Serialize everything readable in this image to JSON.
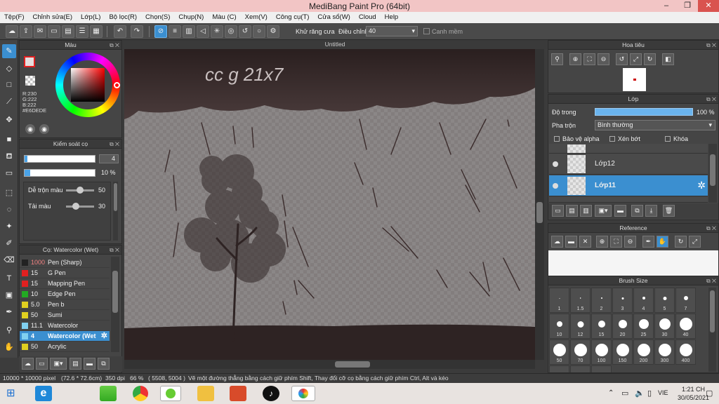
{
  "title": "MediBang Paint Pro (64bit)",
  "window_controls": {
    "minimize": "–",
    "restore": "❐",
    "close": "✕"
  },
  "menu": [
    "Tệp(F)",
    "Chỉnh sửa(E)",
    "Lớp(L)",
    "Bộ lọc(R)",
    "Chọn(S)",
    "Chụp(N)",
    "Màu (C)",
    "Xem(V)",
    "Công cụ(T)",
    "Cửa sổ(W)",
    "Cloud",
    "Help"
  ],
  "toolbar": {
    "antialias_label": "Khử răng cưa",
    "adjust_label": "Điều chỉnh",
    "adjust_value": "40",
    "smooth_label": "Canh mềm"
  },
  "color_panel": {
    "title": "Màu",
    "r": "R:230",
    "g": "G:222",
    "b": "B:222",
    "hex": "#E6DEDE",
    "fg": "#e6dede"
  },
  "brush_control": {
    "title": "Kiểm soát cọ",
    "size": "4",
    "opacity": "10 %",
    "blend_label": "Dễ trộn màu",
    "blend_value": "50",
    "resample_label": "Tải màu",
    "resample_value": "30"
  },
  "brush_panel": {
    "title": "Cọ: Watercolor (Wet)",
    "items": [
      {
        "size": "1000",
        "name": "Pen (Sharp)",
        "color": "#222222"
      },
      {
        "size": "15",
        "name": "G Pen",
        "color": "#e02020"
      },
      {
        "size": "15",
        "name": "Mapping Pen",
        "color": "#e02020"
      },
      {
        "size": "10",
        "name": "Edge Pen",
        "color": "#22aa22"
      },
      {
        "size": "5.0",
        "name": "Pen b",
        "color": "#e0d020"
      },
      {
        "size": "50",
        "name": "Sumi",
        "color": "#e0d020"
      },
      {
        "size": "11.1",
        "name": "Watercolor",
        "color": "#80d0f0"
      },
      {
        "size": "4",
        "name": "Watercolor (Wet",
        "color": "#80d0f0"
      },
      {
        "size": "50",
        "name": "Acrylic",
        "color": "#e0d020"
      }
    ]
  },
  "canvas": {
    "tab": "Untitled",
    "handwriting": "cc g 21x7"
  },
  "navigator": {
    "title": "Hoa tiêu"
  },
  "layer_panel": {
    "title": "Lớp",
    "opacity_label": "Độ trong",
    "opacity_value": "100 %",
    "blend_label": "Pha trộn",
    "blend_value": "Bình thường",
    "protect_alpha": "Bảo vệ alpha",
    "clipping": "Xén bớt",
    "lock": "Khóa",
    "layers": [
      {
        "name": "Lớp12"
      },
      {
        "name": "Lớp11"
      }
    ]
  },
  "reference_panel": {
    "title": "Reference"
  },
  "brush_size_panel": {
    "title": "Brush Size",
    "sizes": [
      "1",
      "1.5",
      "2",
      "3",
      "4",
      "5",
      "7",
      "10",
      "12",
      "15",
      "20",
      "25",
      "30",
      "40",
      "50",
      "70",
      "100",
      "150",
      "200",
      "300",
      "400"
    ]
  },
  "status": {
    "dims": "10000 * 10000 pixel",
    "cm": "(72.6 * 72.6cm)",
    "dpi": "350 dpi",
    "zoom": "66 %",
    "coords": "( 5508, 5004 )",
    "hint": "Vẽ một đường thẳng bằng cách giữ phím Shift, Thay đổi cỡ cọ bằng cách giữ phím Ctrl, Alt và kéo"
  },
  "taskbar": {
    "lang": "VIE",
    "time": "1:21 CH",
    "date": "30/05/2021"
  }
}
